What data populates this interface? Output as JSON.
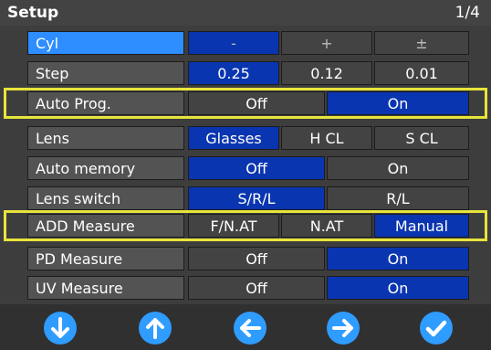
{
  "title": "Setup",
  "page_indicator": "1/4",
  "rows": [
    {
      "label": "Cyl",
      "options": [
        "-",
        "+",
        "±"
      ],
      "selected": 0
    },
    {
      "label": "Step",
      "options": [
        "0.25",
        "0.12",
        "0.01"
      ],
      "selected": 0
    },
    {
      "label": "Auto Prog.",
      "options": [
        "Off",
        "On"
      ],
      "selected": 1
    },
    {
      "label": "Lens",
      "options": [
        "Glasses",
        "H CL",
        "S CL"
      ],
      "selected": 0
    },
    {
      "label": "Auto memory",
      "options": [
        "Off",
        "On"
      ],
      "selected": 0
    },
    {
      "label": "Lens switch",
      "options": [
        "S/R/L",
        "R/L"
      ],
      "selected": 0
    },
    {
      "label": "ADD Measure",
      "options": [
        "F/N.AT",
        "N.AT",
        "Manual"
      ],
      "selected": 2
    },
    {
      "label": "PD Measure",
      "options": [
        "Off",
        "On"
      ],
      "selected": 1
    },
    {
      "label": "UV Measure",
      "options": [
        "Off",
        "On"
      ],
      "selected": 1
    }
  ],
  "buttons": [
    "down-arrow-icon",
    "up-arrow-icon",
    "left-arrow-icon",
    "right-arrow-icon",
    "checkmark-icon"
  ],
  "colors": {
    "selected": "#0a35b0",
    "active_label": "#2e8dff",
    "highlight": "#e7e43c",
    "nav_button": "#2f9cff"
  }
}
